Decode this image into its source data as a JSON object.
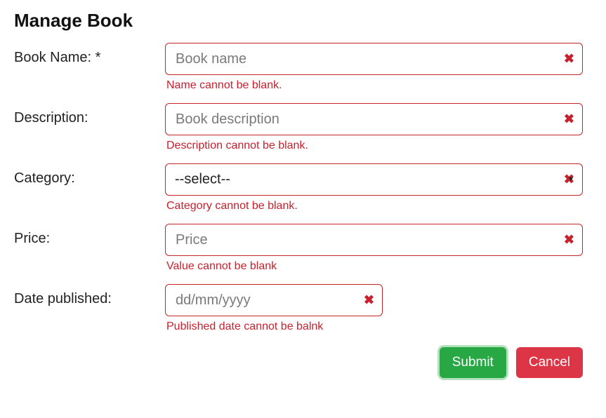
{
  "page": {
    "title": "Manage Book"
  },
  "form": {
    "bookName": {
      "label": "Book Name: *",
      "placeholder": "Book name",
      "error": "Name cannot be blank."
    },
    "description": {
      "label": "Description:",
      "placeholder": "Book description",
      "error": "Description cannot be blank."
    },
    "category": {
      "label": "Category:",
      "selected": "--select--",
      "error": "Category cannot be blank."
    },
    "price": {
      "label": "Price:",
      "placeholder": "Price",
      "error": "Value cannot be blank"
    },
    "datePublished": {
      "label": "Date published:",
      "placeholder": "dd/mm/yyyy",
      "error": "Published date cannot be balnk"
    }
  },
  "buttons": {
    "submit": "Submit",
    "cancel": "Cancel"
  }
}
